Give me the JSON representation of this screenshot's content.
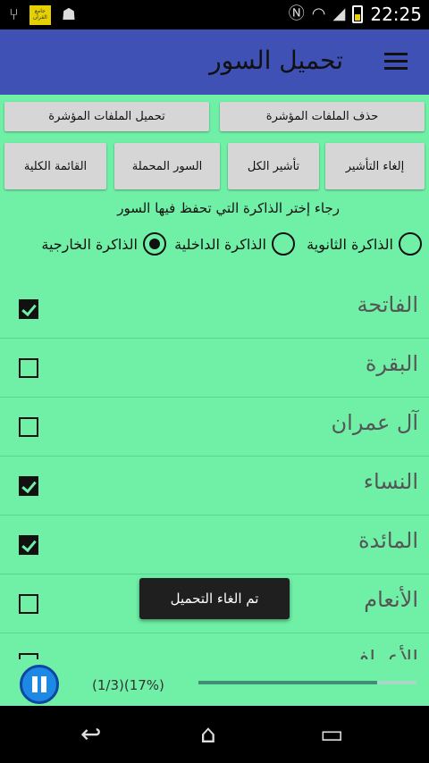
{
  "status_bar": {
    "badge_text": "جامع القرآن",
    "time": "22:25",
    "icons": [
      "usb-icon",
      "android-icon",
      "nfc-icon",
      "wifi-icon",
      "signal-icon",
      "battery-charging-icon"
    ]
  },
  "app_bar": {
    "title": "تحميل السور",
    "menu_icon": "hamburger-menu-icon",
    "color": "#3f51b5"
  },
  "buttons_row1": {
    "delete_marked": "حذف الملفات المؤشرة",
    "download_marked": "تحميل الملفات المؤشرة"
  },
  "buttons_row2": {
    "unmark": "إلغاء التأشير",
    "mark_all": "تأشير الكل",
    "downloaded_surahs": "السور المحملة",
    "full_list": "القائمة الكلية"
  },
  "memory_hint": "رجاء إختر الذاكرة التي تحفظ فيها السور",
  "memory_options": [
    {
      "label": "الذاكرة الثانوية",
      "selected": false
    },
    {
      "label": "الذاكرة الداخلية",
      "selected": false
    },
    {
      "label": "الذاكرة الخارجية",
      "selected": true
    }
  ],
  "surahs": [
    {
      "name": "الفاتحة",
      "checked": true
    },
    {
      "name": "البقرة",
      "checked": false
    },
    {
      "name": "آل عمران",
      "checked": false
    },
    {
      "name": "النساء",
      "checked": true
    },
    {
      "name": "المائدة",
      "checked": true
    },
    {
      "name": "الأنعام",
      "checked": false
    },
    {
      "name": "الأعراف",
      "checked": false
    }
  ],
  "toast": "تم الغاء التحميل",
  "player": {
    "progress_text": "(1/3)(17%)",
    "progress_fraction": 0.82
  },
  "colors": {
    "content_bg": "#6ff0a6",
    "button_bg": "#d6d6d6",
    "accent_blue": "#1e88e5"
  },
  "nav": {
    "back": "↩",
    "home": "⌂",
    "recents": "▭"
  }
}
